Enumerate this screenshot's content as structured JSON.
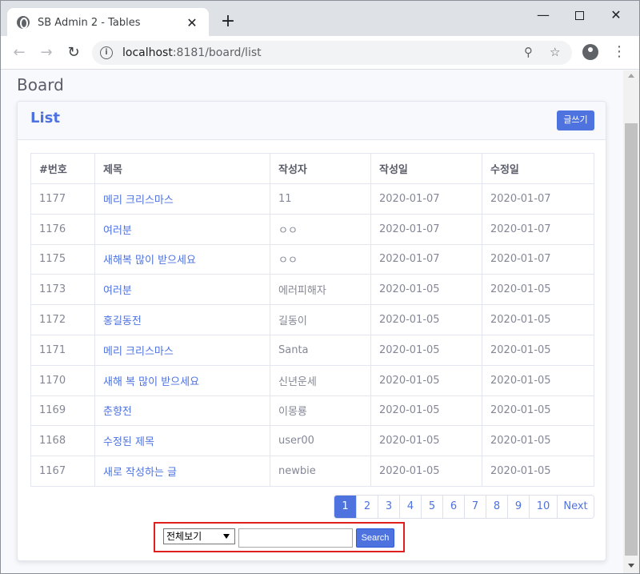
{
  "browser": {
    "tab_title": "SB Admin 2 - Tables",
    "tab_close": "✕",
    "new_tab": "+",
    "url_host": "localhost",
    "url_rest": ":8181/board/list",
    "win_min": "—",
    "win_close": "✕"
  },
  "page": {
    "heading": "Board",
    "card_title": "List",
    "write_button": "글쓰기"
  },
  "table": {
    "headers": [
      "#번호",
      "제목",
      "작성자",
      "작성일",
      "수정일"
    ],
    "rows": [
      {
        "no": "1177",
        "title": "메리 크리스마스",
        "writer": "11",
        "created": "2020-01-07",
        "updated": "2020-01-07"
      },
      {
        "no": "1176",
        "title": "여러분",
        "writer": "ㅇㅇ",
        "created": "2020-01-07",
        "updated": "2020-01-07"
      },
      {
        "no": "1175",
        "title": "새해복 많이 받으세요",
        "writer": "ㅇㅇ",
        "created": "2020-01-07",
        "updated": "2020-01-07"
      },
      {
        "no": "1173",
        "title": "여러분",
        "writer": "에러피해자",
        "created": "2020-01-05",
        "updated": "2020-01-05"
      },
      {
        "no": "1172",
        "title": "홍길동전",
        "writer": "길동이",
        "created": "2020-01-05",
        "updated": "2020-01-05"
      },
      {
        "no": "1171",
        "title": "메리 크리스마스",
        "writer": "Santa",
        "created": "2020-01-05",
        "updated": "2020-01-05"
      },
      {
        "no": "1170",
        "title": "새해 복 많이 받으세요",
        "writer": "신년운세",
        "created": "2020-01-05",
        "updated": "2020-01-05"
      },
      {
        "no": "1169",
        "title": "춘향전",
        "writer": "이몽룡",
        "created": "2020-01-05",
        "updated": "2020-01-05"
      },
      {
        "no": "1168",
        "title": "수정된 제목",
        "writer": "user00",
        "created": "2020-01-05",
        "updated": "2020-01-05"
      },
      {
        "no": "1167",
        "title": "새로 작성하는 글",
        "writer": "newbie",
        "created": "2020-01-05",
        "updated": "2020-01-05"
      }
    ]
  },
  "pagination": {
    "pages": [
      "1",
      "2",
      "3",
      "4",
      "5",
      "6",
      "7",
      "8",
      "9",
      "10"
    ],
    "active": "1",
    "next_label": "Next"
  },
  "search": {
    "select_value": "전체보기",
    "input_value": "",
    "button_label": "Search"
  },
  "colors": {
    "primary": "#4e73df",
    "highlight_border": "#e0201e"
  }
}
